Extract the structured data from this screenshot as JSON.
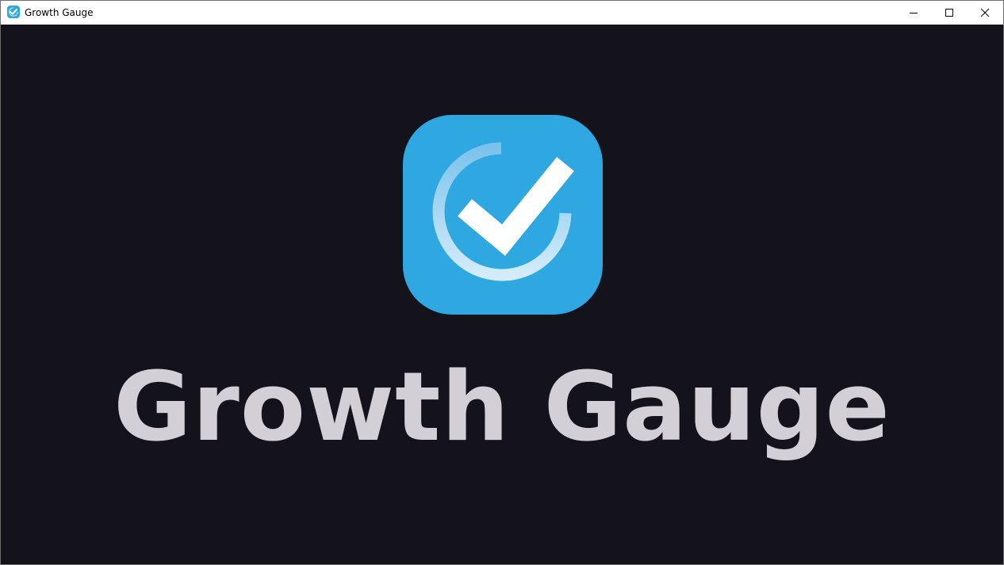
{
  "window": {
    "title": "Growth Gauge",
    "app_icon": "checkmark-gauge-icon",
    "controls": {
      "minimize_icon": "minimize-icon",
      "maximize_icon": "maximize-icon",
      "close_icon": "close-icon"
    }
  },
  "splash": {
    "logo_icon": "checkmark-gauge-icon",
    "brand_name": "Growth Gauge"
  },
  "colors": {
    "background": "#14121a",
    "logo_blue": "#2fa8e1",
    "brand_text": "#d3cfd6",
    "titlebar": "#ffffff"
  }
}
